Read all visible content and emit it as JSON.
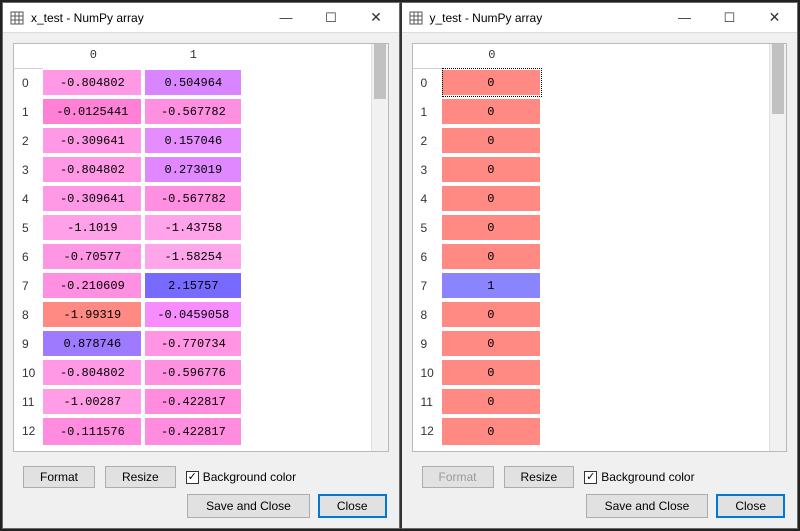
{
  "windows": [
    {
      "key": "x",
      "title": "x_test - NumPy array",
      "columns": [
        "0",
        "1"
      ],
      "rows": [
        [
          "-0.804802",
          "0.504964"
        ],
        [
          "-0.0125441",
          "-0.567782"
        ],
        [
          "-0.309641",
          "0.157046"
        ],
        [
          "-0.804802",
          "0.273019"
        ],
        [
          "-0.309641",
          "-0.567782"
        ],
        [
          "-1.1019",
          "-1.43758"
        ],
        [
          "-0.70577",
          "-1.58254"
        ],
        [
          "-0.210609",
          "2.15757"
        ],
        [
          "-1.99319",
          "-0.0459058"
        ],
        [
          "0.878746",
          "-0.770734"
        ],
        [
          "-0.804802",
          "-0.596776"
        ],
        [
          "-1.00287",
          "-0.422817"
        ],
        [
          "-0.111576",
          "-0.422817"
        ]
      ],
      "cell_colors": [
        [
          "#ff99e5",
          "#d985ff"
        ],
        [
          "#ff80d4",
          "#ff8fe0"
        ],
        [
          "#ff99e5",
          "#e58cff"
        ],
        [
          "#ff99e5",
          "#df88ff"
        ],
        [
          "#ff99e5",
          "#ff8fe0"
        ],
        [
          "#ffa0e8",
          "#ffa3ea"
        ],
        [
          "#ff96e3",
          "#ffa6eb"
        ],
        [
          "#ff8fe0",
          "#776bff"
        ],
        [
          "#ff8a84",
          "#f78cff"
        ],
        [
          "#9d7aff",
          "#ff95e3"
        ],
        [
          "#ff99e5",
          "#ff91e1"
        ],
        [
          "#ff9de6",
          "#ff8cde"
        ],
        [
          "#ff8cde",
          "#ff8cde"
        ]
      ],
      "format_enabled": true,
      "thumb_h": 55
    },
    {
      "key": "y",
      "title": "y_test - NumPy array",
      "columns": [
        "0"
      ],
      "rows": [
        [
          "0"
        ],
        [
          "0"
        ],
        [
          "0"
        ],
        [
          "0"
        ],
        [
          "0"
        ],
        [
          "0"
        ],
        [
          "0"
        ],
        [
          "1"
        ],
        [
          "0"
        ],
        [
          "0"
        ],
        [
          "0"
        ],
        [
          "0"
        ],
        [
          "0"
        ]
      ],
      "cell_colors": [
        [
          "#ff8a84"
        ],
        [
          "#ff8a84"
        ],
        [
          "#ff8a84"
        ],
        [
          "#ff8a84"
        ],
        [
          "#ff8a84"
        ],
        [
          "#ff8a84"
        ],
        [
          "#ff8a84"
        ],
        [
          "#8a84ff"
        ],
        [
          "#ff8a84"
        ],
        [
          "#ff8a84"
        ],
        [
          "#ff8a84"
        ],
        [
          "#ff8a84"
        ],
        [
          "#ff8a84"
        ]
      ],
      "format_enabled": false,
      "thumb_h": 70
    }
  ],
  "labels": {
    "format": "Format",
    "resize": "Resize",
    "bg_color": "Background color",
    "save_close": "Save and Close",
    "close": "Close",
    "checkmark": "✓",
    "minimize": "—",
    "maximize": "☐",
    "x": "✕"
  }
}
